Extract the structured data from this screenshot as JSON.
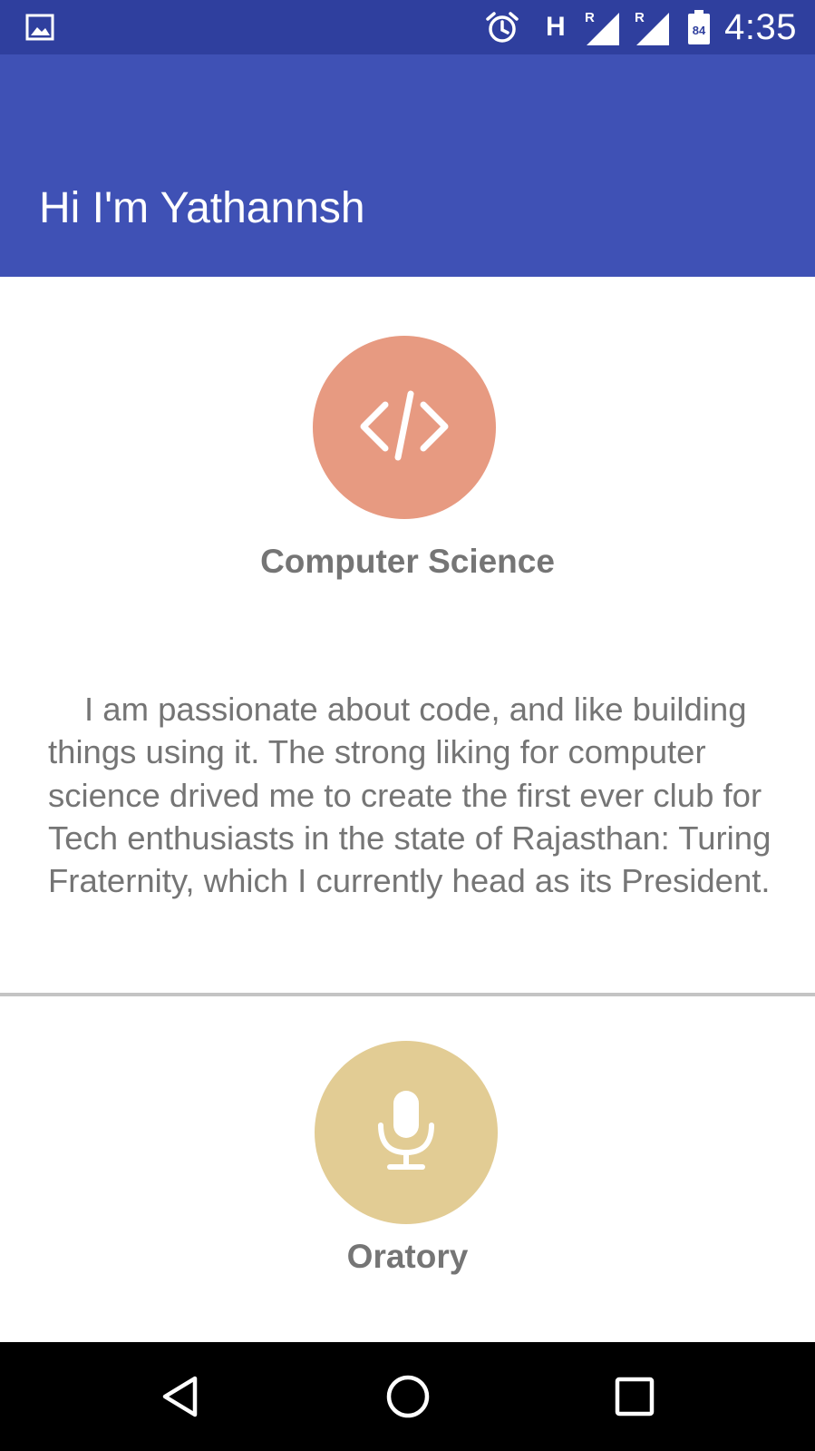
{
  "status_bar": {
    "time": "4:35",
    "network_type": "H",
    "roaming_label": "R",
    "battery_level": "84",
    "icons": [
      "image-icon",
      "alarm-icon",
      "signal-icon",
      "signal-icon",
      "battery-icon"
    ]
  },
  "app_bar": {
    "title": "Hi I'm Yathannsh",
    "color": "#3f51b5"
  },
  "sections": [
    {
      "title": "Computer Science",
      "icon": "code-icon",
      "color": "#e79a81",
      "description": "I am passionate about code, and like building things using it. The strong liking for computer science drived me to create the first ever club for Tech enthusiasts in the state of Rajasthan: Turing Fraternity, which I currently head as its President."
    },
    {
      "title": "Oratory",
      "icon": "microphone-icon",
      "color": "#e2cc94"
    }
  ],
  "nav_bar": {
    "buttons": [
      "back-icon",
      "home-icon",
      "recents-icon"
    ]
  }
}
